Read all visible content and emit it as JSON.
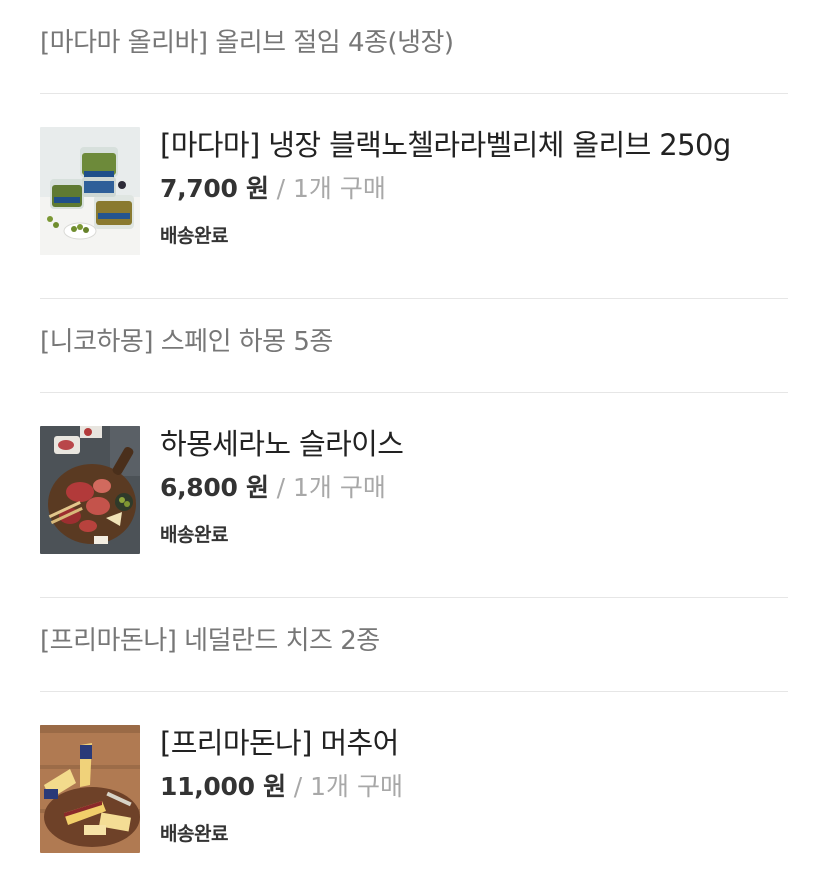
{
  "groups": [
    {
      "title": "[마다마 올리바] 올리브 절임 4종(냉장)",
      "item": {
        "name": "[마다마] 냉장 블랙노첼라라벨리체 올리브 250g",
        "price": "7,700 원",
        "separator": "/",
        "quantity": "1개 구매",
        "status": "배송완료",
        "image_icon": "olive-jars-photo"
      }
    },
    {
      "title": "[니코하몽] 스페인 하몽 5종",
      "item": {
        "name": "하몽세라노 슬라이스",
        "price": "6,800 원",
        "separator": "/",
        "quantity": "1개 구매",
        "status": "배송완료",
        "image_icon": "jamon-board-photo"
      }
    },
    {
      "title": "[프리마돈나] 네덜란드 치즈 2종",
      "item": {
        "name": "[프리마돈나] 머추어",
        "price": "11,000 원",
        "separator": "/",
        "quantity": "1개 구매",
        "status": "배송완료",
        "image_icon": "cheese-board-photo"
      }
    }
  ]
}
